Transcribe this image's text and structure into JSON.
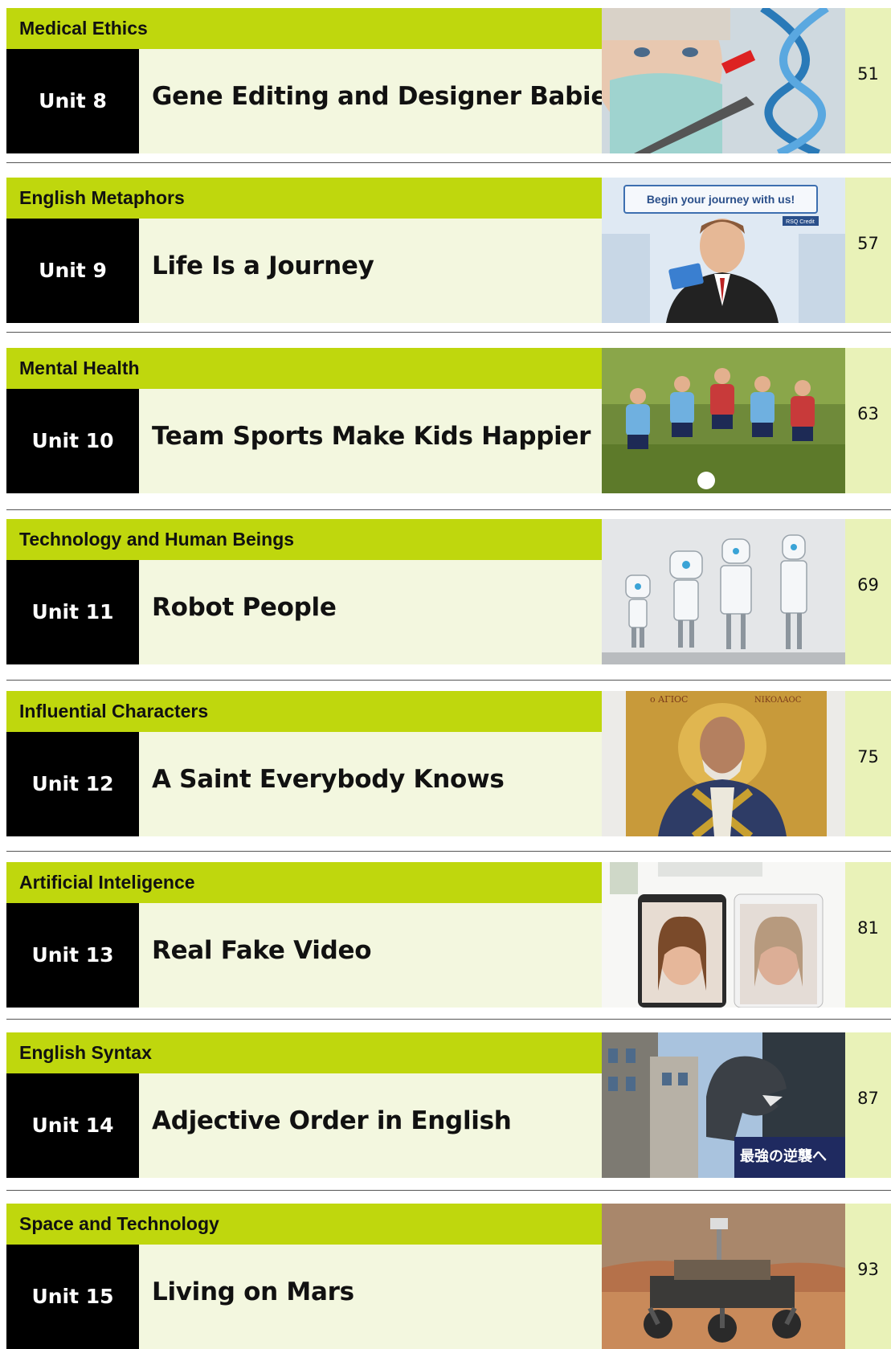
{
  "units": [
    {
      "category": "Medical Ethics",
      "unit": "Unit 8",
      "title": "Gene Editing and Designer Babies",
      "page": "51",
      "image": "dna-editing-photo"
    },
    {
      "category": "English Metaphors",
      "unit": "Unit 9",
      "title": "Life Is a Journey",
      "page": "57",
      "image": "journey-ad-photo",
      "image_text": "Begin your journey with us!",
      "image_subtext": "RSQ Credit"
    },
    {
      "category": "Mental Health",
      "unit": "Unit 10",
      "title": "Team Sports Make Kids Happier",
      "page": "63",
      "image": "kids-soccer-photo"
    },
    {
      "category": "Technology and Human Beings",
      "unit": "Unit 11",
      "title": "Robot People",
      "page": "69",
      "image": "robots-photo"
    },
    {
      "category": "Influential Characters",
      "unit": "Unit 12",
      "title": "A Saint Everybody Knows",
      "page": "75",
      "image": "saint-mosaic-photo",
      "image_text": "o ΑΓΙΟC",
      "image_subtext": "NIKOΛAOC"
    },
    {
      "category": "Artificial Inteligence",
      "unit": "Unit 13",
      "title": "Real Fake Video",
      "page": "81",
      "image": "face-tablets-photo"
    },
    {
      "category": "English Syntax",
      "unit": "Unit 14",
      "title": "Adjective Order in English",
      "page": "87",
      "image": "godzilla-street-photo",
      "image_text": "最強の逆襲へ"
    },
    {
      "category": "Space and Technology",
      "unit": "Unit 15",
      "title": "Living on Mars",
      "page": "93",
      "image": "mars-rover-photo"
    }
  ],
  "colors": {
    "category_bar": "#bfd70d",
    "title_bg": "#f3f7df",
    "page_bg": "#e9f2b8",
    "unit_bg": "#000000"
  }
}
